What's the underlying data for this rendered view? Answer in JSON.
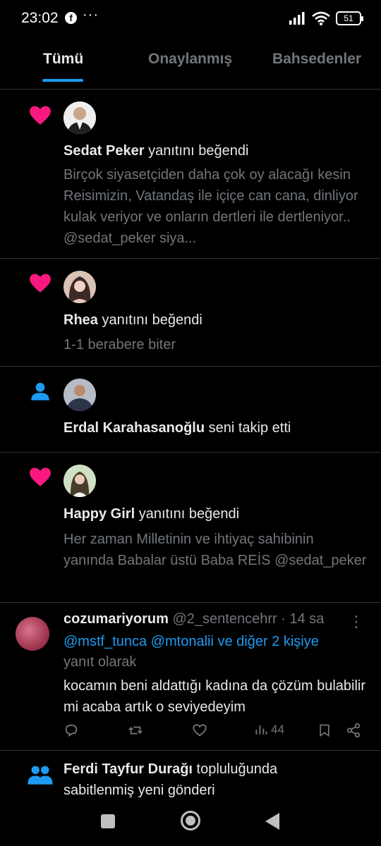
{
  "status_bar": {
    "time": "23:02",
    "fb": "f",
    "more": "···",
    "battery": "51"
  },
  "tabs": [
    {
      "label": "Tümü"
    },
    {
      "label": "Onaylanmış"
    },
    {
      "label": "Bahsedenler"
    }
  ],
  "notifications": [
    {
      "type": "like",
      "name": "Sedat Peker",
      "action": " yanıtını beğendi",
      "body": "Birçok siyasetçiden daha çok oy alacağı kesin Reisimizin, Vatandaş ile içiçe can cana, dinliyor kulak veriyor ve onların dertleri ile dertleniyor.. @sedat_peker siya..."
    },
    {
      "type": "like",
      "name": "Rhea",
      "action": " yanıtını beğendi",
      "body": "1-1 berabere biter"
    },
    {
      "type": "follow",
      "name": "Erdal Karahasanoğlu",
      "action": " seni takip etti",
      "body": ""
    },
    {
      "type": "like",
      "name": "Happy Girl",
      "action": " yanıtını beğendi",
      "body": "Her zaman Milletinin ve ihtiyaç sahibinin yanında Babalar üstü Baba REİS @sedat_peker"
    }
  ],
  "tweet": {
    "name": "cozumariyorum",
    "handle": "@2_sentencehrr · 14 sa",
    "reply_to": "@mstf_tunca @mtonalii ve diğer 2 kişiye",
    "reply_suffix": "yanıt olarak",
    "text": "kocamın beni aldattığı kadına da çözüm bulabilir mi acaba artık o seviyedeyim",
    "views": "44"
  },
  "community": {
    "name": "Ferdi Tayfur Durağı",
    "action": " topluluğunda",
    "line2": "sabitlenmiş yeni gönderi"
  },
  "colors": {
    "accent": "#1d9bf0",
    "like": "#f91880",
    "muted": "#71767b"
  }
}
